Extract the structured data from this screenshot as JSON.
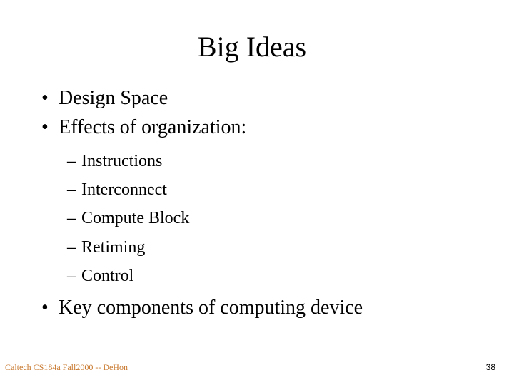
{
  "slide": {
    "title": "Big Ideas",
    "bullet_glyph": "•",
    "dash_glyph": "–",
    "bullets": [
      {
        "text": "Design Space"
      },
      {
        "text": "Effects of organization:"
      },
      {
        "text": "Key components of computing device"
      }
    ],
    "sub_bullets": [
      {
        "text": "Instructions"
      },
      {
        "text": "Interconnect"
      },
      {
        "text": "Compute Block"
      },
      {
        "text": "Retiming"
      },
      {
        "text": "Control"
      }
    ]
  },
  "footer": {
    "course": "Caltech CS184a Fall2000 -- DeHon",
    "page_number": "38",
    "course_color": "#c8782d"
  }
}
